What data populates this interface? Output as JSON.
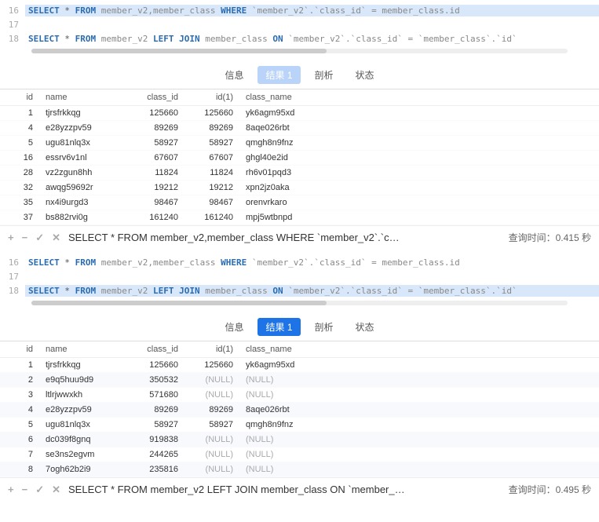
{
  "tabs": {
    "info": "信息",
    "result": "结果 1",
    "analysis": "剖析",
    "status": "状态"
  },
  "columns": {
    "id": "id",
    "name": "name",
    "class_id": "class_id",
    "id1": "id(1)",
    "class_name": "class_name"
  },
  "icons": {
    "plus": "+",
    "minus": "−",
    "check": "✓",
    "x": "✕"
  },
  "status": {
    "qtime_label": "查询时间：",
    "sec_unit": "秒"
  },
  "sql": {
    "select": "SELECT",
    "star": "*",
    "from": "FROM",
    "where": "WHERE",
    "leftjoin": "LEFT JOIN",
    "on": "ON",
    "tables1": "member_v2,member_class",
    "table_mv2": "member_v2",
    "table_mc": "member_class",
    "cond1": "`member_v2`.`class_id` = member_class.id",
    "cond2": "`member_v2`.`class_id` = `member_class`.`id`"
  },
  "lines": {
    "l16": "16",
    "l17": "17",
    "l18": "18"
  },
  "panel1": {
    "status_query": "SELECT * FROM member_v2,member_class WHERE `member_v2`.`c…",
    "qtime_value": "0.415",
    "rows": [
      {
        "id": "1",
        "name": "tjrsfrkkqg",
        "cid": "125660",
        "id1": "125660",
        "cn": "yk6agm95xd"
      },
      {
        "id": "4",
        "name": "e28yzzpv59",
        "cid": "89269",
        "id1": "89269",
        "cn": "8aqe026rbt"
      },
      {
        "id": "5",
        "name": "ugu81nlq3x",
        "cid": "58927",
        "id1": "58927",
        "cn": "qmgh8n9fnz"
      },
      {
        "id": "16",
        "name": "essrv6v1nl",
        "cid": "67607",
        "id1": "67607",
        "cn": "ghgl40e2id"
      },
      {
        "id": "28",
        "name": "vz2zgun8hh",
        "cid": "11824",
        "id1": "11824",
        "cn": "rh6v01pqd3"
      },
      {
        "id": "32",
        "name": "awqg59692r",
        "cid": "19212",
        "id1": "19212",
        "cn": "xpn2jz0aka"
      },
      {
        "id": "35",
        "name": "nx4i9urgd3",
        "cid": "98467",
        "id1": "98467",
        "cn": "orenvrkaro"
      },
      {
        "id": "37",
        "name": "bs882rvi0g",
        "cid": "161240",
        "id1": "161240",
        "cn": "mpj5wtbnpd"
      }
    ]
  },
  "panel2": {
    "status_query": "SELECT * FROM member_v2 LEFT JOIN member_class ON `member_…",
    "qtime_value": "0.495",
    "rows": [
      {
        "id": "1",
        "name": "tjrsfrkkqg",
        "cid": "125660",
        "id1": "125660",
        "cn": "yk6agm95xd"
      },
      {
        "id": "2",
        "name": "e9q5huu9d9",
        "cid": "350532",
        "id1": "(NULL)",
        "cn": "(NULL)",
        "null": true
      },
      {
        "id": "3",
        "name": "ltlrjwwxkh",
        "cid": "571680",
        "id1": "(NULL)",
        "cn": "(NULL)",
        "null": true
      },
      {
        "id": "4",
        "name": "e28yzzpv59",
        "cid": "89269",
        "id1": "89269",
        "cn": "8aqe026rbt"
      },
      {
        "id": "5",
        "name": "ugu81nlq3x",
        "cid": "58927",
        "id1": "58927",
        "cn": "qmgh8n9fnz"
      },
      {
        "id": "6",
        "name": "dc039f8gnq",
        "cid": "919838",
        "id1": "(NULL)",
        "cn": "(NULL)",
        "null": true
      },
      {
        "id": "7",
        "name": "se3ns2egvm",
        "cid": "244265",
        "id1": "(NULL)",
        "cn": "(NULL)",
        "null": true
      },
      {
        "id": "8",
        "name": "7ogh62b2i9",
        "cid": "235816",
        "id1": "(NULL)",
        "cn": "(NULL)",
        "null": true
      }
    ]
  }
}
